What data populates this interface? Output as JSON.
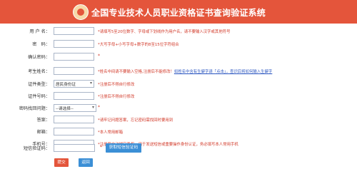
{
  "header": {
    "title": "全国专业技术人员职业资格证书查询验证系统"
  },
  "form": {
    "rows": [
      {
        "label": "用 户 名：",
        "value": "",
        "hint": "*请填写5至20位数字、字母或下划线作为用户名，请不要输入汉字或其他符号"
      },
      {
        "label": "密　码：",
        "value": "",
        "hint": "*大写字母+小写字母+数字的8至15位字符组合"
      },
      {
        "label": "确认密码：",
        "value": "",
        "hint": "*"
      },
      {
        "label": "考生姓名：",
        "value": "",
        "hint": "*姓名中间请不要输入空格,注册后不能修改！",
        "link": "如姓名中含有生僻字请「点击」，查识后将如何输入生僻字"
      },
      {
        "label": "证件类型：",
        "value": "居民身份证",
        "hint": "*注册后不得自行修改"
      },
      {
        "label": "证件号码：",
        "value": "",
        "hint": "*注册后不得自行修改"
      },
      {
        "label": "密码找回问题：",
        "value": "--请选择--",
        "hint": "*"
      },
      {
        "label": "答案：",
        "value": "",
        "hint": "*请牢记问题答案，忘记密码需找回时要用到"
      },
      {
        "label": "邮箱：",
        "value": "",
        "hint": "*本人常用邮箱"
      },
      {
        "label": "手机号：",
        "value": "",
        "hint": "*注册后自动绑定手机，用于发送短信或重要操作身份认证，务必填写本人常用手机"
      },
      {
        "label": "短信验证码：",
        "value": "",
        "hint": "*"
      }
    ],
    "sms_button": "获取短信验证码",
    "submit_label": "提交",
    "back_label": "返回"
  }
}
